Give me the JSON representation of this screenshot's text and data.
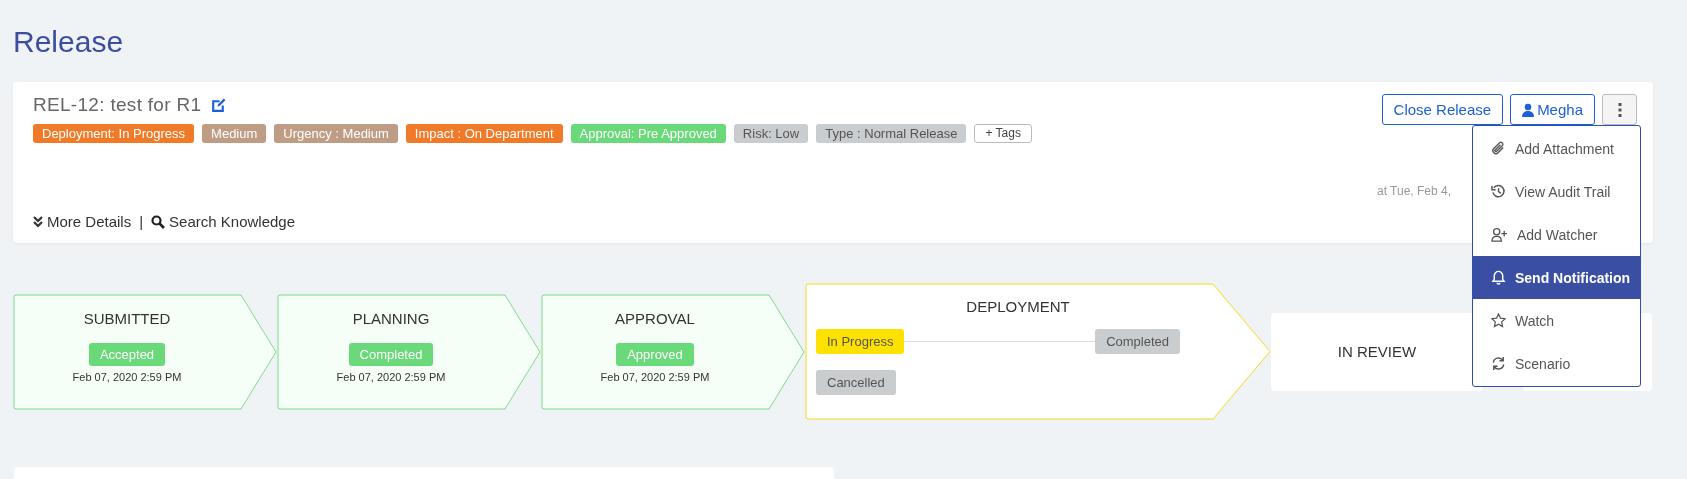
{
  "page_title": "Release",
  "release": {
    "title": "REL-12: test for R1",
    "tags": [
      {
        "label": "Deployment: In Progress",
        "color": "#f07a28"
      },
      {
        "label": "Medium",
        "color": "#bf9c84"
      },
      {
        "label": "Urgency : Medium",
        "color": "#bf9c84"
      },
      {
        "label": "Impact : On Department",
        "color": "#f07a28"
      },
      {
        "label": "Approval: Pre Approved",
        "color": "#6ad97a"
      },
      {
        "label": "Risk: Low",
        "color": "#c9cdcf"
      },
      {
        "label": "Type : Normal Release",
        "color": "#c9cdcf"
      }
    ],
    "add_tag": "+ Tags",
    "timestamp": "at Tue, Feb 4,",
    "more_details": "More Details",
    "separator": "|",
    "search_knowledge": "Search Knowledge"
  },
  "actions": {
    "close": "Close Release",
    "assignee": "Megha"
  },
  "menu": {
    "expanded": true,
    "items": [
      {
        "label": "Add Attachment",
        "selected": false
      },
      {
        "label": "View Audit Trail",
        "selected": false
      },
      {
        "label": "Add Watcher",
        "selected": false
      },
      {
        "label": "Send Notification",
        "selected": true
      },
      {
        "label": "Watch",
        "selected": false
      },
      {
        "label": "Scenario",
        "selected": false
      }
    ]
  },
  "stages": [
    {
      "kind": "done",
      "name": "SUBMITTED",
      "status": "Accepted",
      "date": "Feb 07, 2020 2:59 PM"
    },
    {
      "kind": "done",
      "name": "PLANNING",
      "status": "Completed",
      "date": "Feb 07, 2020 2:59 PM"
    },
    {
      "kind": "done",
      "name": "APPROVAL",
      "status": "Approved",
      "date": "Feb 07, 2020 2:59 PM"
    },
    {
      "kind": "current",
      "name": "DEPLOYMENT",
      "options": [
        {
          "label": "In Progress",
          "selected": true
        },
        {
          "label": "Completed",
          "selected": false
        },
        {
          "label": "Cancelled",
          "selected": false
        }
      ]
    },
    {
      "kind": "pending",
      "name": "IN REVIEW"
    }
  ]
}
